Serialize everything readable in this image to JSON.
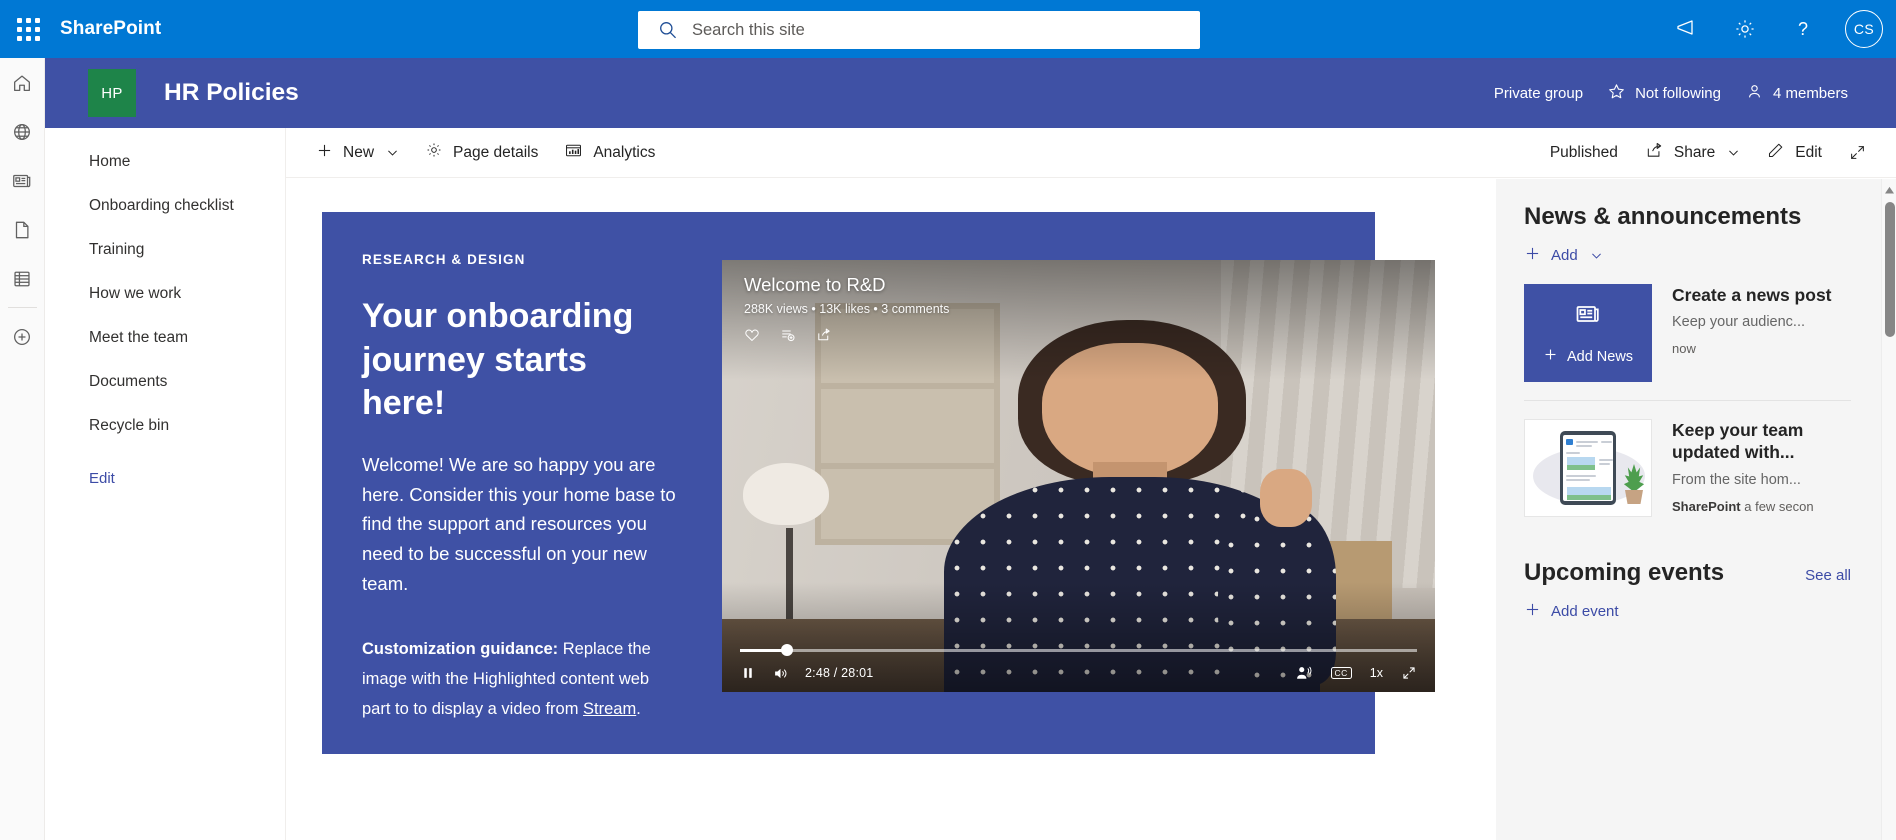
{
  "suite": {
    "brand": "SharePoint",
    "waffle_label": "app-launcher",
    "search_placeholder": "Search this site",
    "search_value": "",
    "icons": [
      "megaphone-icon",
      "gear-icon",
      "help-icon"
    ],
    "avatar_initials": "CS",
    "bar_color": "#0078d4"
  },
  "rail": {
    "items": [
      "home-icon",
      "globe-icon",
      "news-icon",
      "page-icon",
      "lists-icon"
    ],
    "create_label": "create-icon"
  },
  "site": {
    "logo_initials": "HP",
    "logo_color": "#1e8449",
    "title": "HR Policies",
    "header_color": "#3f51a5",
    "privacy": "Private group",
    "follow": "Not following",
    "members": "4 members"
  },
  "commandbar": {
    "new_label": "New",
    "page_details_label": "Page details",
    "analytics_label": "Analytics",
    "published_label": "Published",
    "share_label": "Share",
    "edit_label": "Edit",
    "expand_label": "full-screen-icon"
  },
  "leftnav": {
    "items": [
      {
        "label": "Home"
      },
      {
        "label": "Onboarding checklist"
      },
      {
        "label": "Training"
      },
      {
        "label": "How we work"
      },
      {
        "label": "Meet the team"
      },
      {
        "label": "Documents"
      },
      {
        "label": "Recycle bin"
      }
    ],
    "edit_label": "Edit"
  },
  "hero": {
    "eyebrow": "RESEARCH & DESIGN",
    "heading": "Your onboarding journey starts here!",
    "paragraph": "Welcome! We are so happy you are here. Consider this your home base to find the support and resources you need to be successful on your new team.",
    "note_bold": "Customization guidance:",
    "note_text": " Replace the image with the Highlighted content web part to to display a video from ",
    "note_link": "Stream",
    "note_end": ".",
    "background_color": "#3f51a5"
  },
  "video": {
    "title": "Welcome to R&D",
    "meta": "288K views • 13K likes • 3 comments",
    "actions": [
      "heart-icon",
      "add-to-playlist-icon",
      "share-icon"
    ],
    "play_state": "pause-icon",
    "volume": "volume-icon",
    "time": "2:48 / 28:01",
    "progress_percent": 7,
    "noise_suppression": "noise-suppression-icon",
    "captions": "CC",
    "speed": "1x",
    "fullscreen": "fullscreen-icon"
  },
  "news": {
    "heading": "News & announcements",
    "add_label": "Add",
    "items": [
      {
        "thumb_label": "Add News",
        "title": "Create a news post",
        "description": "Keep your audienc...",
        "author": "",
        "time": "now"
      },
      {
        "thumb_label": "",
        "title": "Keep your team updated with...",
        "description": "From the site hom...",
        "author": "SharePoint",
        "time": "a few secon"
      }
    ]
  },
  "events": {
    "heading": "Upcoming events",
    "see_all": "See all",
    "add_label": "Add event"
  }
}
